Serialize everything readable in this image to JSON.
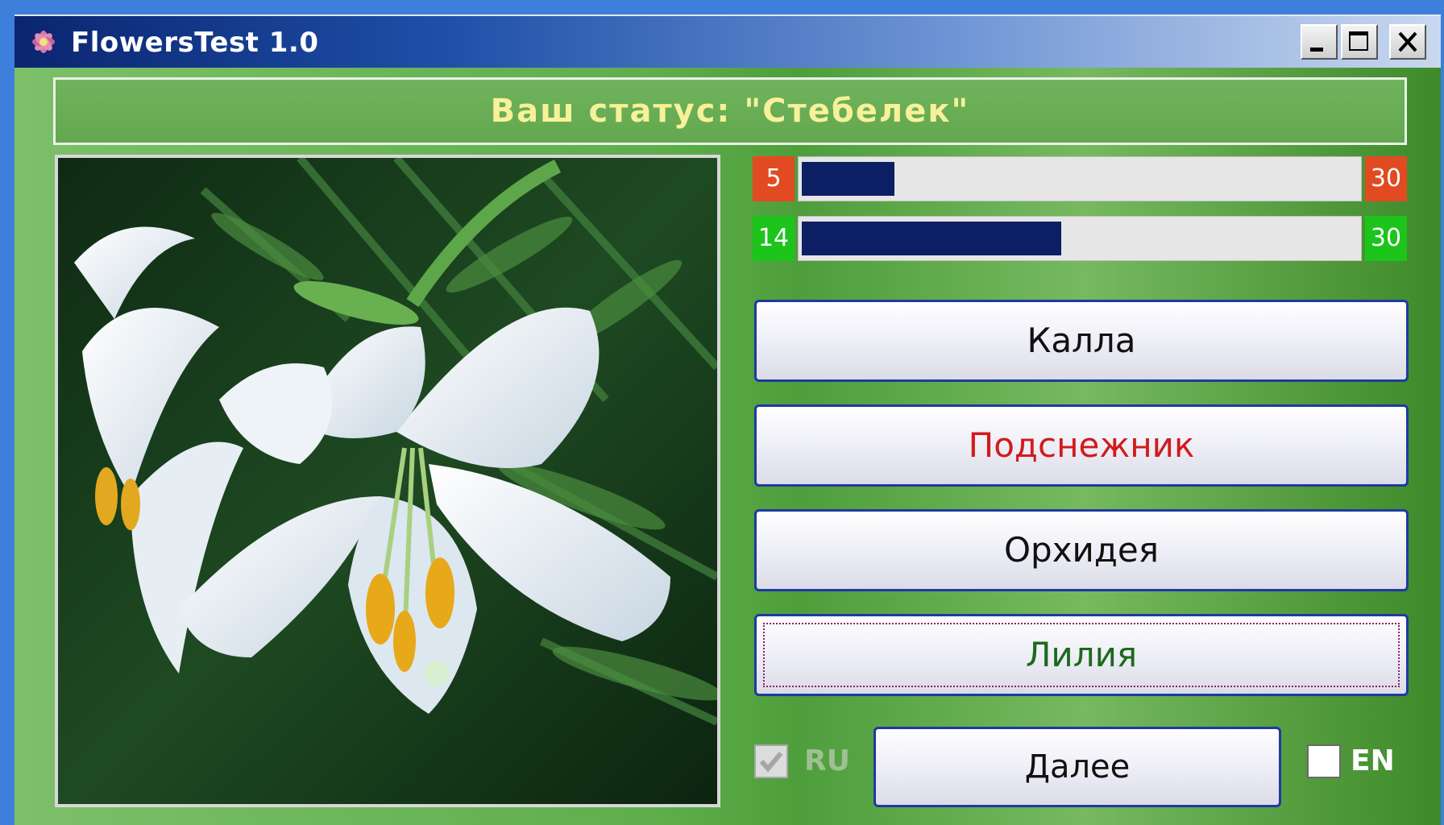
{
  "window": {
    "title": "FlowersTest 1.0",
    "icon": "flower-icon",
    "controls": {
      "minimize": "minimize-icon",
      "maximize": "maximize-icon",
      "close": "close-icon"
    }
  },
  "status": {
    "text": "Ваш статус: \"Стебелек\""
  },
  "progress": [
    {
      "current": "5",
      "total": "30",
      "fraction": 0.167,
      "color": "#e24a22"
    },
    {
      "current": "14",
      "total": "30",
      "fraction": 0.467,
      "color": "#1cc41c"
    }
  ],
  "answers": [
    {
      "label": "Калла",
      "color": "#111111"
    },
    {
      "label": "Подснежник",
      "color": "#d11b1b"
    },
    {
      "label": "Орхидея",
      "color": "#111111"
    },
    {
      "label": "Лилия",
      "color": "#1c6a1c",
      "focused": true
    }
  ],
  "language": {
    "ru": {
      "label": "RU",
      "checked": true,
      "enabled": false
    },
    "en": {
      "label": "EN",
      "checked": false,
      "enabled": true
    }
  },
  "next_button": {
    "label": "Далее"
  },
  "colors": {
    "titlebar_dark": "#0b2570",
    "status_text": "#f7f19a",
    "progress_fill": "#0d1f64",
    "button_border": "#1f3aa0"
  }
}
